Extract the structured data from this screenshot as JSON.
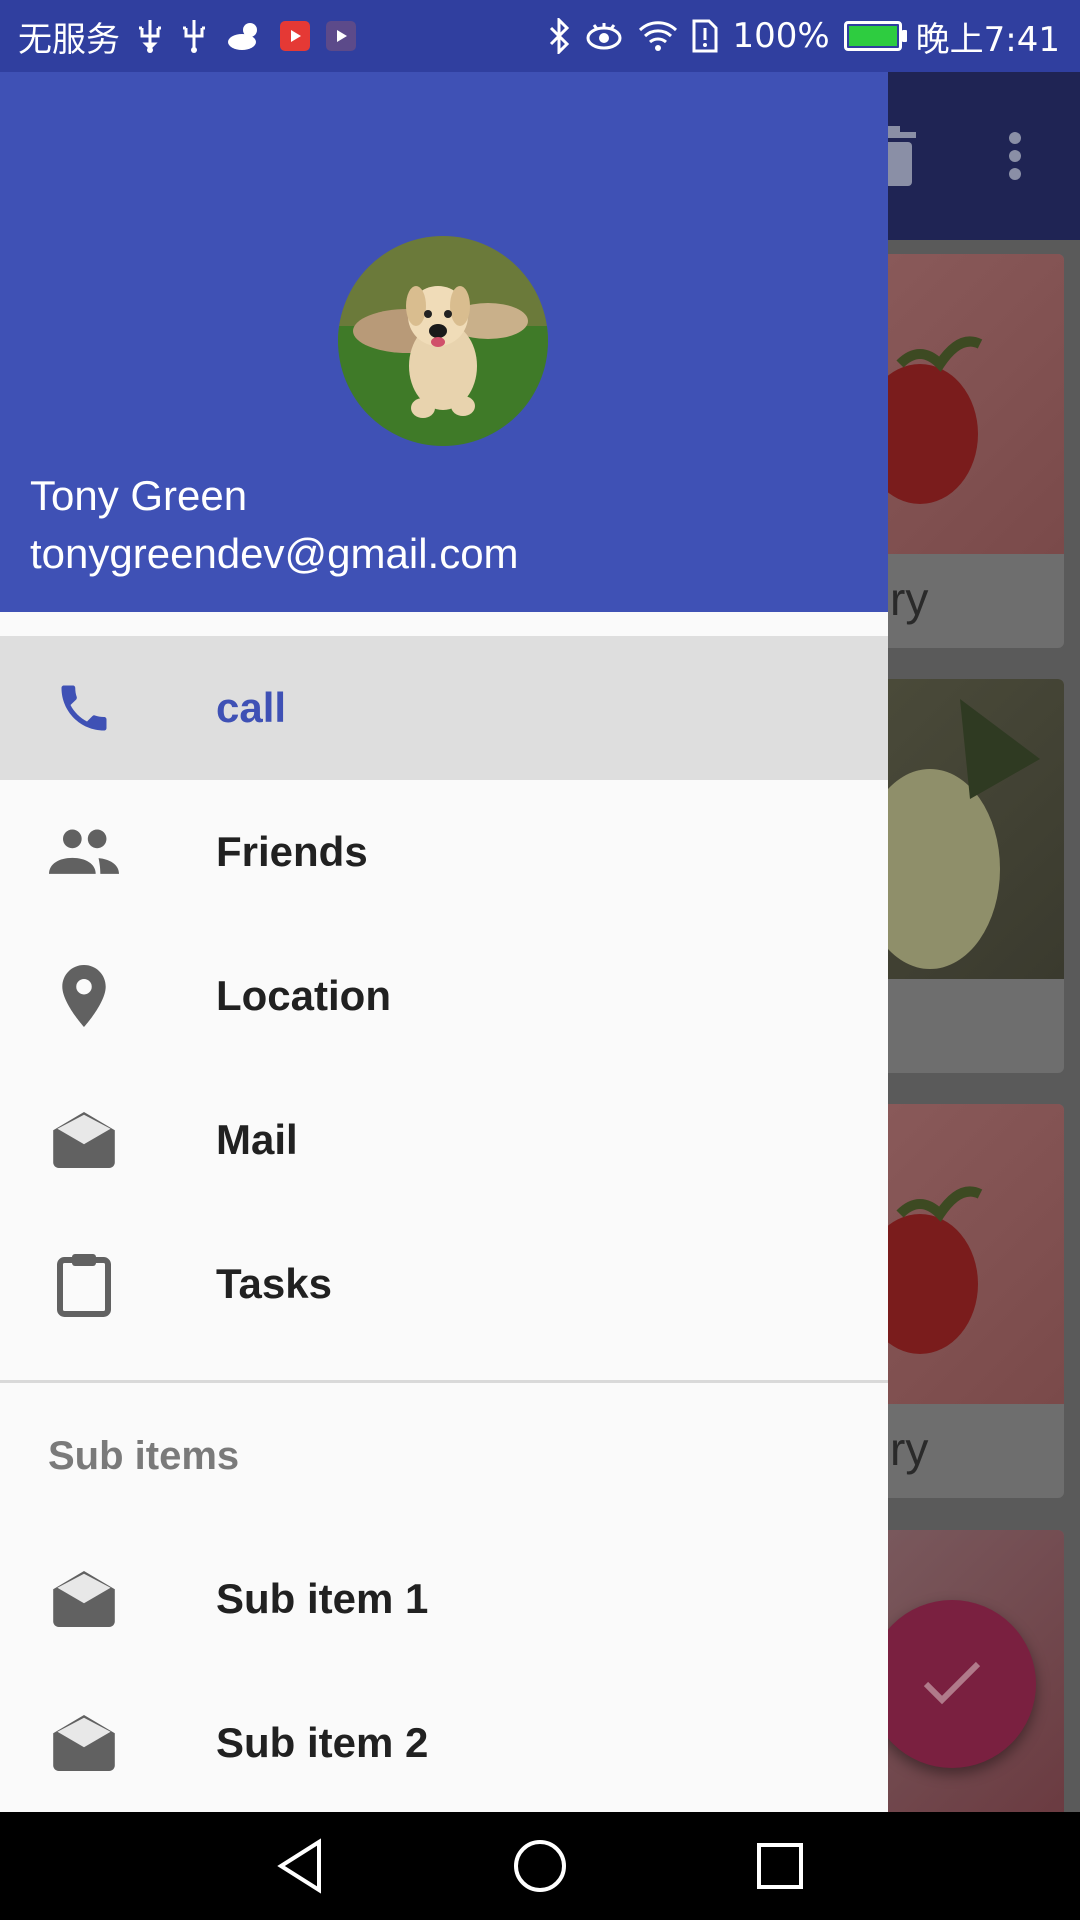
{
  "status_bar": {
    "carrier": "无服务",
    "battery": "100%",
    "battery_level": 1.0,
    "time": "晚上7:41",
    "icons": [
      "usb-icon",
      "usb-icon",
      "weather-icon",
      "video-app-icon",
      "media-app-icon",
      "bluetooth-icon",
      "eye-icon",
      "wifi-icon",
      "sim-alert-icon",
      "battery-icon"
    ]
  },
  "colors": {
    "primary": "#3f51b5",
    "primary_dark": "#303f9f",
    "accent": "#ff4081",
    "active_item_bg": "#dedede",
    "drawer_bg": "#fafafa"
  },
  "drawer": {
    "header": {
      "name": "Tony Green",
      "email": "tonygreendev@gmail.com"
    },
    "items": [
      {
        "label": "call",
        "icon": "phone-icon",
        "active": true
      },
      {
        "label": "Friends",
        "icon": "people-icon",
        "active": false
      },
      {
        "label": "Location",
        "icon": "location-pin-icon",
        "active": false
      },
      {
        "label": "Mail",
        "icon": "mail-icon",
        "active": false
      },
      {
        "label": "Tasks",
        "icon": "clipboard-icon",
        "active": false
      }
    ],
    "section_title": "Sub items",
    "sub_items": [
      {
        "label": "Sub item 1",
        "icon": "mail-icon"
      },
      {
        "label": "Sub item 2",
        "icon": "mail-icon"
      }
    ]
  },
  "background_app": {
    "toolbar_icons": [
      "delete-icon",
      "more-vert-icon"
    ],
    "card_label_fragments": [
      "ry",
      "",
      "ry"
    ],
    "fab_icon": "check-icon"
  }
}
